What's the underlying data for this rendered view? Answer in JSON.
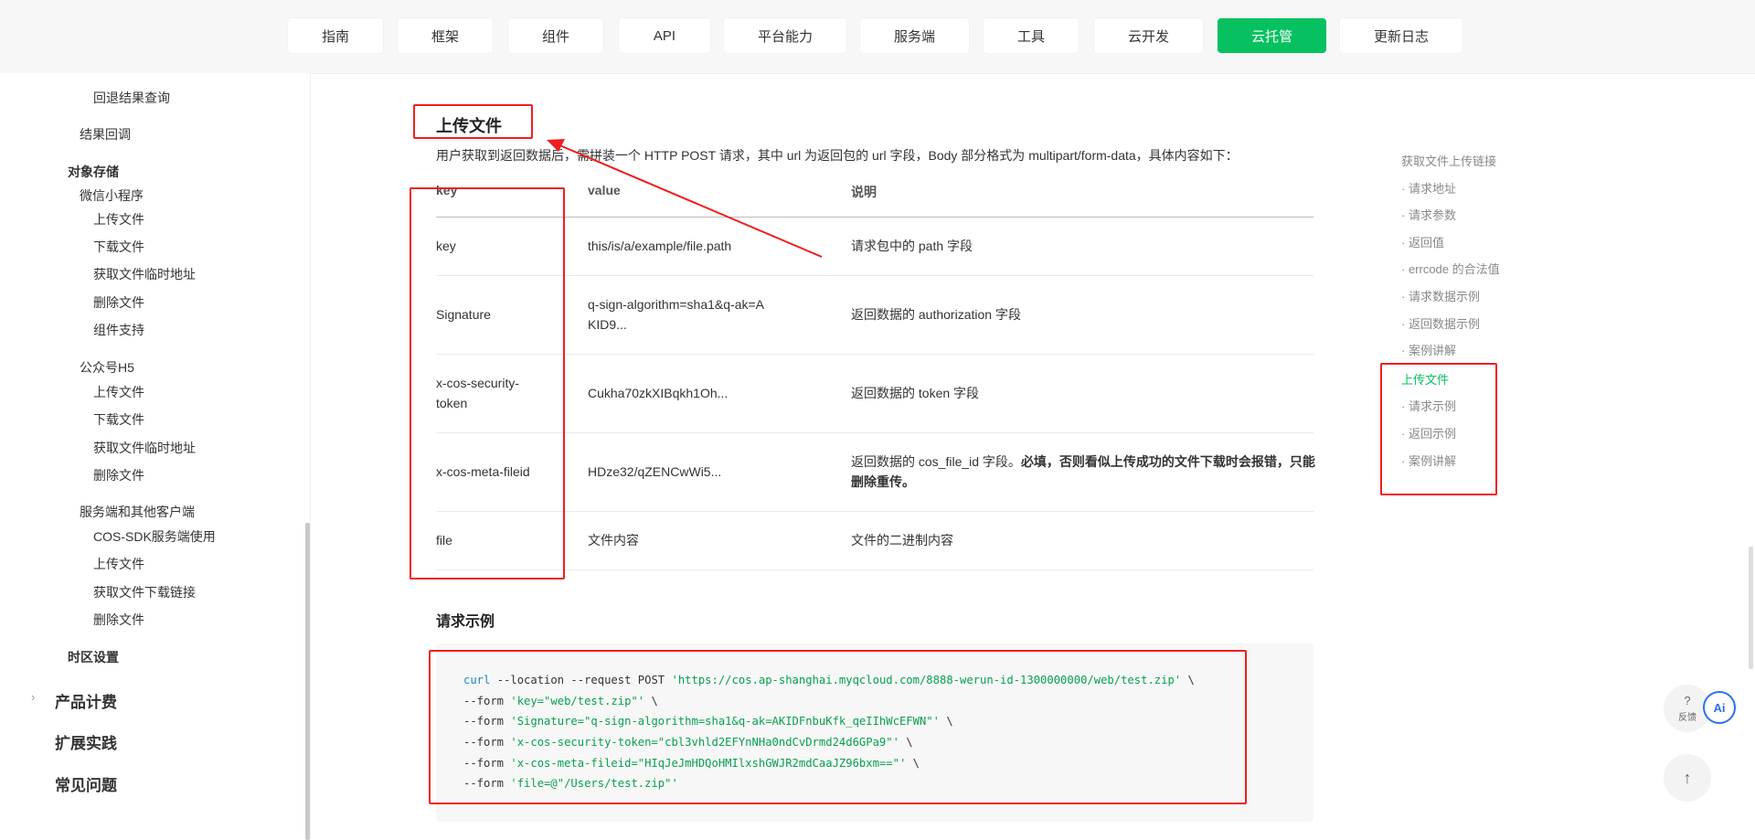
{
  "nav": {
    "tabs": [
      {
        "label": "指南"
      },
      {
        "label": "框架"
      },
      {
        "label": "组件"
      },
      {
        "label": "API"
      },
      {
        "label": "平台能力"
      },
      {
        "label": "服务端"
      },
      {
        "label": "工具"
      },
      {
        "label": "云开发"
      },
      {
        "label": "云托管"
      },
      {
        "label": "更新日志"
      }
    ],
    "active": "云托管"
  },
  "sidebar": {
    "items": [
      {
        "label": "回退结果查询"
      },
      {
        "label": "结果回调"
      },
      {
        "label": "对象存储"
      },
      {
        "label": "微信小程序"
      },
      {
        "label": "上传文件"
      },
      {
        "label": "下载文件"
      },
      {
        "label": "获取文件临时地址"
      },
      {
        "label": "删除文件"
      },
      {
        "label": "组件支持"
      },
      {
        "label": "公众号H5"
      },
      {
        "label": "上传文件"
      },
      {
        "label": "下载文件"
      },
      {
        "label": "获取文件临时地址"
      },
      {
        "label": "删除文件"
      },
      {
        "label": "服务端和其他客户端"
      },
      {
        "label": "COS-SDK服务端使用"
      },
      {
        "label": "上传文件"
      },
      {
        "label": "获取文件下载链接"
      },
      {
        "label": "删除文件"
      },
      {
        "label": "时区设置"
      },
      {
        "label": "产品计费"
      },
      {
        "label": "扩展实践"
      },
      {
        "label": "常见问题"
      }
    ],
    "chevron": "›"
  },
  "main": {
    "heading": "上传文件",
    "description": "用户获取到返回数据后，需拼装一个 HTTP POST 请求，其中 url 为返回包的 url 字段，Body 部分格式为 multipart/form-data，具体内容如下：",
    "table": {
      "headers": [
        "key",
        "value",
        "说明"
      ],
      "rows": [
        {
          "key": "key",
          "value": "this/is/a/example/file.path",
          "desc": "请求包中的 path 字段"
        },
        {
          "key": "Signature",
          "value": "q-sign-algorithm=sha1&q-ak=AKID9...",
          "desc": "返回数据的 authorization 字段"
        },
        {
          "key": "x-cos-security-token",
          "value": "Cukha70zkXIBqkh1Oh...",
          "desc": "返回数据的 token 字段"
        },
        {
          "key": "x-cos-meta-fileid",
          "value": "HDze32/qZENCwWi5...",
          "desc": "返回数据的 cos_file_id 字段。",
          "desc_bold": "必填，否则看似上传成功的文件下载时会报错，只能删除重传。"
        },
        {
          "key": "file",
          "value": "文件内容",
          "desc": "文件的二进制内容"
        }
      ]
    },
    "request_heading": "请求示例",
    "code": {
      "line1_cmd": "curl",
      "line1_opts": " --location --request POST ",
      "line1_url": "'https://cos.ap-shanghai.myqcloud.com/8888-werun-id-1300000000/web/test.zip'",
      "line1_end": " \\",
      "form": "--form ",
      "line2": "'key=\"web/test.zip\"'",
      "line3": "'Signature=\"q-sign-algorithm=sha1&q-ak=AKIDFnbuKfk_qeIIhWcEFWN\"'",
      "line4": "'x-cos-security-token=\"cbl3vhld2EFYnNHa0ndCvDrmd24d6GPa9\"'",
      "line5": "'x-cos-meta-fileid=\"HIqJeJmHDQoHMIlxshGWJR2mdCaaJZ96bxm==\"'",
      "line6": "'file=@\"/Users/test.zip\"'",
      "cont": " \\"
    }
  },
  "toc": {
    "items": [
      {
        "label": "获取文件上传链接"
      },
      {
        "label": "· 请求地址"
      },
      {
        "label": "· 请求参数"
      },
      {
        "label": "· 返回值"
      },
      {
        "label": "· errcode 的合法值"
      },
      {
        "label": "· 请求数据示例"
      },
      {
        "label": "· 返回数据示例"
      },
      {
        "label": "· 案例讲解"
      },
      {
        "label": "上传文件"
      },
      {
        "label": "· 请求示例"
      },
      {
        "label": "· 返回示例"
      },
      {
        "label": "· 案例讲解"
      }
    ],
    "active": "上传文件"
  },
  "floating": {
    "feedback_q": "?",
    "feedback_label": "反馈",
    "ai_label": "Ai",
    "top_arrow": "↑"
  },
  "colors": {
    "accent": "#07c160",
    "annotation": "#ee1f1f",
    "code_keyword": "#1e88c8",
    "code_string": "#07a04f"
  }
}
